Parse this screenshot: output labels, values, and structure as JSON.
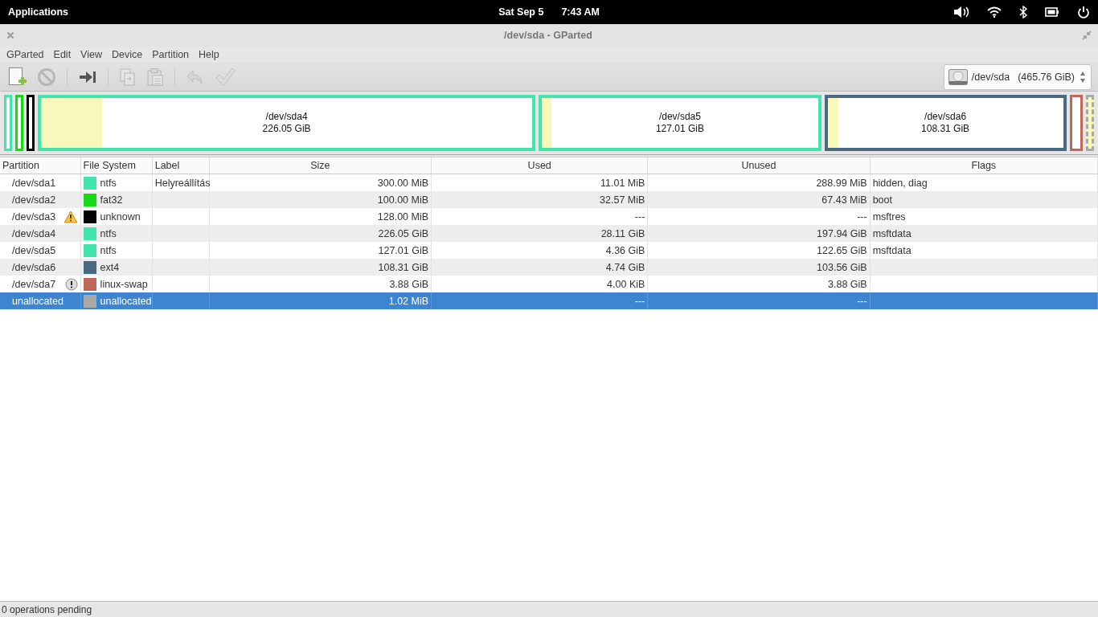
{
  "top_panel": {
    "menu": "Applications",
    "date": "Sat Sep  5",
    "time": "7:43 AM"
  },
  "window": {
    "title": "/dev/sda - GParted"
  },
  "menubar": [
    "GParted",
    "Edit",
    "View",
    "Device",
    "Partition",
    "Help"
  ],
  "toolbar": [
    {
      "kind": "new",
      "disabled": false
    },
    {
      "kind": "delete",
      "disabled": true
    },
    {
      "kind": "separator"
    },
    {
      "kind": "resize",
      "disabled": false
    },
    {
      "kind": "separator"
    },
    {
      "kind": "copy",
      "disabled": true
    },
    {
      "kind": "paste",
      "disabled": true
    },
    {
      "kind": "separator"
    },
    {
      "kind": "undo",
      "disabled": true
    },
    {
      "kind": "apply",
      "disabled": true
    }
  ],
  "device_selector": {
    "device": "/dev/sda",
    "size": "(465.76 GiB)"
  },
  "partition_map": [
    {
      "kind": "partition"
    },
    {
      "kind": "partition"
    },
    {
      "kind": "partition"
    },
    {
      "kind": "partition",
      "level": 0.125,
      "name": "/dev/sda4",
      "size": "226.05 GiB"
    },
    {
      "kind": "partition",
      "level": 0.034,
      "name": "/dev/sda5",
      "size": "127.01 GiB"
    },
    {
      "kind": "partition",
      "level": 0.044,
      "name": "/dev/sda6",
      "size": "108.31 GiB"
    },
    {
      "kind": "partition"
    },
    {
      "kind": "unallocated"
    }
  ],
  "table": {
    "columns": [
      "Partition",
      "File System",
      "Label",
      "Size",
      "Used",
      "Unused",
      "Flags"
    ],
    "rows": [
      {
        "partition": "/dev/sda1",
        "warning": false,
        "busy": false,
        "file_system": "ntfs",
        "color": "#42e5ac",
        "label": "Helyreállítás",
        "size": "300.00 MiB",
        "used": "11.01 MiB",
        "unused": "288.99 MiB",
        "flags": "hidden, diag",
        "selected": false
      },
      {
        "partition": "/dev/sda2",
        "warning": false,
        "busy": false,
        "file_system": "fat32",
        "color": "#18d918",
        "size": "100.00 MiB",
        "used": "32.57 MiB",
        "unused": "67.43 MiB",
        "flags": "boot",
        "selected": false
      },
      {
        "partition": "/dev/sda3",
        "warning": true,
        "busy": false,
        "file_system": "unknown",
        "color": "#000000",
        "size": "128.00 MiB",
        "used": "---",
        "unused": "---",
        "flags": "msftres",
        "selected": false
      },
      {
        "partition": "/dev/sda4",
        "warning": false,
        "busy": false,
        "file_system": "ntfs",
        "color": "#42e5ac",
        "size": "226.05 GiB",
        "used": "28.11 GiB",
        "unused": "197.94 GiB",
        "flags": "msftdata",
        "selected": false
      },
      {
        "partition": "/dev/sda5",
        "warning": false,
        "busy": false,
        "file_system": "ntfs",
        "color": "#42e5ac",
        "size": "127.01 GiB",
        "used": "4.36 GiB",
        "unused": "122.65 GiB",
        "flags": "msftdata",
        "selected": false
      },
      {
        "partition": "/dev/sda6",
        "warning": false,
        "busy": false,
        "file_system": "ext4",
        "color": "#4b6983",
        "size": "108.31 GiB",
        "used": "4.74 GiB",
        "unused": "103.56 GiB",
        "selected": false
      },
      {
        "partition": "/dev/sda7",
        "warning": false,
        "busy": true,
        "file_system": "linux-swap",
        "color": "#c1665a",
        "size": "3.88 GiB",
        "used": "4.00 KiB",
        "unused": "3.88 GiB",
        "selected": false
      },
      {
        "partition": "unallocated",
        "warning": false,
        "busy": false,
        "file_system": "unallocated",
        "color": "#a9a9a9",
        "size": "1.02 MiB",
        "used": "---",
        "unused": "---",
        "selected": true
      }
    ]
  },
  "status_bar": "0 operations pending"
}
